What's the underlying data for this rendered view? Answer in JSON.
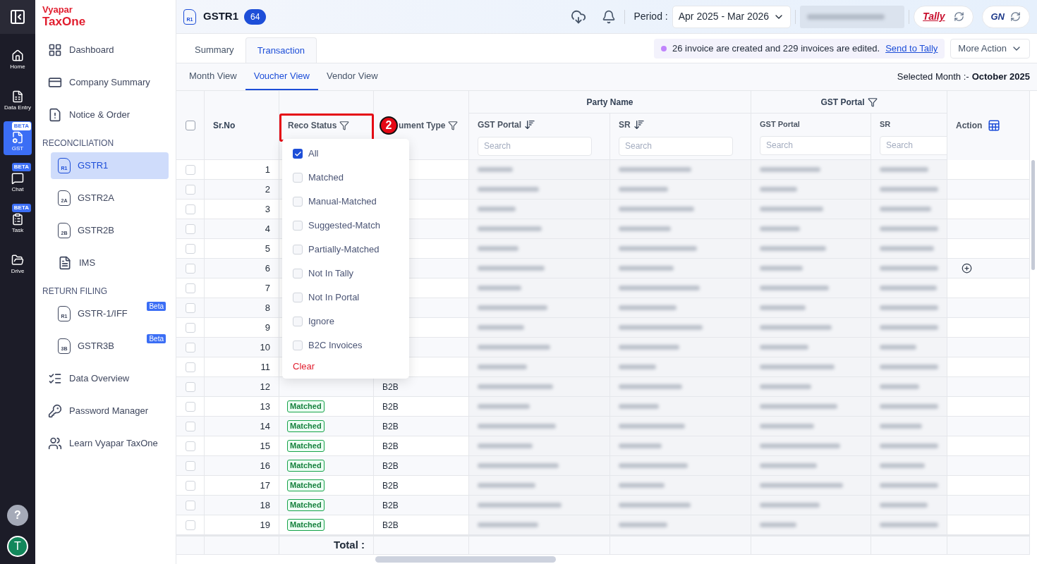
{
  "rail": {
    "items": [
      {
        "label": "Home",
        "selected": false
      },
      {
        "label": "Data Entry",
        "selected": false
      },
      {
        "label": "GST",
        "selected": true,
        "badge": "BETA"
      },
      {
        "label": "Chat",
        "selected": false,
        "badge": "BETA"
      },
      {
        "label": "Task",
        "selected": false,
        "badge": "BETA"
      },
      {
        "label": "Drive",
        "selected": false
      }
    ],
    "help": "?",
    "avatar": "T"
  },
  "sidebar": {
    "logo_top": "Vyapar",
    "logo_bottom": "TaxOne",
    "sections": [
      {
        "items": [
          {
            "label": "Dashboard",
            "selected": false
          },
          {
            "label": "Company Summary",
            "selected": false
          },
          {
            "label": "Notice & Order",
            "selected": false
          }
        ]
      },
      {
        "title": "RECONCILIATION",
        "items": [
          {
            "label": "GSTR1",
            "icon_text": "R1",
            "selected": true
          },
          {
            "label": "GSTR2A",
            "icon_text": "2A",
            "selected": false
          },
          {
            "label": "GSTR2B",
            "icon_text": "2B",
            "selected": false
          },
          {
            "label": "IMS",
            "selected": false
          }
        ]
      },
      {
        "title": "RETURN FILING",
        "items": [
          {
            "label": "GSTR-1/IFF",
            "icon_text": "R1",
            "selected": false,
            "badge": "Beta"
          },
          {
            "label": "GSTR3B",
            "icon_text": "3B",
            "selected": false,
            "badge": "Beta"
          }
        ]
      },
      {
        "items": [
          {
            "label": "Data Overview",
            "selected": false
          },
          {
            "label": "Password Manager",
            "selected": false
          },
          {
            "label": "Learn Vyapar TaxOne",
            "selected": false
          }
        ]
      }
    ]
  },
  "header": {
    "icon_text": "R1",
    "title": "GSTR1",
    "count": "64",
    "period_label": "Period :",
    "period": "Apr 2025 - Mar 2026",
    "tally_logo": "Tally",
    "gstn_logo": "GN"
  },
  "tabs": [
    {
      "label": "Summary",
      "selected": false
    },
    {
      "label": "Transaction",
      "selected": true
    }
  ],
  "notice": {
    "text": "26 invoice are created and 229 invoices are edited.",
    "link": "Send to Tally",
    "color": "#c084fc"
  },
  "more_action": "More Action",
  "views": [
    {
      "label": "Month View",
      "selected": false
    },
    {
      "label": "Voucher View",
      "selected": true
    },
    {
      "label": "Vendor View",
      "selected": false
    }
  ],
  "selected_month": {
    "label": "Selected Month :-",
    "value": "October 2025"
  },
  "table": {
    "sr_header": "Sr.No",
    "reco_header": "Reco Status",
    "doc_header": "ument Type",
    "party_group": "Party Name",
    "gst_group": "GST Portal",
    "party_cols": [
      "GST Portal",
      "SR"
    ],
    "gst_cols": [
      "GST Portal",
      "SR"
    ],
    "search_placeholders": [
      "Search",
      "Search",
      "Search",
      "Search"
    ],
    "action_header": "Action",
    "select_all_checked": false,
    "rows": [
      {
        "sr": "1",
        "checked": false,
        "add": false
      },
      {
        "sr": "2",
        "checked": false,
        "add": false
      },
      {
        "sr": "3",
        "checked": false,
        "add": false
      },
      {
        "sr": "4",
        "checked": false,
        "add": false
      },
      {
        "sr": "5",
        "checked": false,
        "add": false
      },
      {
        "sr": "6",
        "checked": false,
        "add": true
      },
      {
        "sr": "7",
        "checked": false,
        "add": false
      },
      {
        "sr": "8",
        "checked": false,
        "add": false
      },
      {
        "sr": "9",
        "checked": false,
        "add": false
      },
      {
        "sr": "10",
        "checked": false,
        "add": false
      },
      {
        "sr": "11",
        "checked": false,
        "add": false
      },
      {
        "sr": "12",
        "doc": "B2B",
        "checked": false,
        "add": false
      },
      {
        "sr": "13",
        "status": "Matched",
        "doc": "B2B",
        "checked": false,
        "add": false
      },
      {
        "sr": "14",
        "status": "Matched",
        "doc": "B2B",
        "checked": false,
        "add": false
      },
      {
        "sr": "15",
        "status": "Matched",
        "doc": "B2B",
        "checked": false,
        "add": false
      },
      {
        "sr": "16",
        "status": "Matched",
        "doc": "B2B",
        "checked": false,
        "add": false
      },
      {
        "sr": "17",
        "status": "Matched",
        "doc": "B2B",
        "checked": false,
        "add": false
      },
      {
        "sr": "18",
        "status": "Matched",
        "doc": "B2B",
        "checked": false,
        "add": false
      },
      {
        "sr": "19",
        "status": "Matched",
        "doc": "B2B",
        "checked": false,
        "add": false
      }
    ],
    "total_label": "Total :"
  },
  "callout": {
    "number": "2"
  },
  "filter_menu": {
    "options": [
      {
        "label": "All",
        "checked": true
      },
      {
        "label": "Matched",
        "checked": false
      },
      {
        "label": "Manual-Matched",
        "checked": false
      },
      {
        "label": "Suggested-Match",
        "checked": false
      },
      {
        "label": "Partially-Matched",
        "checked": false
      },
      {
        "label": "Not In Tally",
        "checked": false
      },
      {
        "label": "Not In Portal",
        "checked": false
      },
      {
        "label": "Ignore",
        "checked": false
      },
      {
        "label": "B2C Invoices",
        "checked": false
      }
    ],
    "clear": "Clear"
  }
}
